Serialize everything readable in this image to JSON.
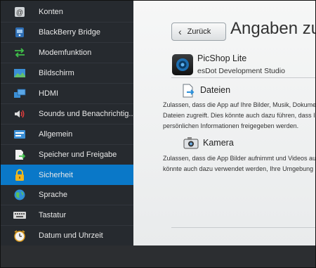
{
  "sidebar": {
    "items": [
      {
        "label": "Konten",
        "icon": "accounts-icon",
        "active": false
      },
      {
        "label": "BlackBerry Bridge",
        "icon": "blackberry-bridge-icon",
        "active": false
      },
      {
        "label": "Modemfunktion",
        "icon": "modem-arrows-icon",
        "active": false
      },
      {
        "label": "Bildschirm",
        "icon": "display-icon",
        "active": false
      },
      {
        "label": "HDMI",
        "icon": "hdmi-icon",
        "active": false
      },
      {
        "label": "Sounds und Benachrichtig...",
        "icon": "speaker-icon",
        "active": false
      },
      {
        "label": "Allgemein",
        "icon": "general-icon",
        "active": false
      },
      {
        "label": "Speicher und Freigabe",
        "icon": "storage-share-icon",
        "active": false
      },
      {
        "label": "Sicherheit",
        "icon": "lock-icon",
        "active": true
      },
      {
        "label": "Sprache",
        "icon": "globe-icon",
        "active": false
      },
      {
        "label": "Tastatur",
        "icon": "keyboard-icon",
        "active": false
      },
      {
        "label": "Datum und Uhrzeit",
        "icon": "clock-icon",
        "active": false
      }
    ]
  },
  "header": {
    "back_label": "Zurück",
    "title": "Angaben zu Berechtigungen"
  },
  "app": {
    "name": "PicShop Lite",
    "developer": "esDot Development Studio"
  },
  "permissions": [
    {
      "title": "Dateien",
      "icon": "files-icon",
      "desc_line1": "Zulassen, dass die App auf Ihre Bilder, Musik, Dokumente und andere",
      "desc_line2": "Dateien zugreift. Dies könnte auch dazu führen, dass Ihre",
      "desc_line3": "persönlichen Informationen freigegeben werden."
    },
    {
      "title": "Kamera",
      "icon": "camera-icon",
      "desc_line1": "Zulassen, dass die App Bilder aufnimmt und Videos aufzeichnet. Dies",
      "desc_line2": "könnte auch dazu verwendet werden, Ihre Umgebung aufzuzeichnen."
    }
  ],
  "colors": {
    "active_blue": "#0a78c8",
    "sidebar_bg": "#262a2f"
  }
}
